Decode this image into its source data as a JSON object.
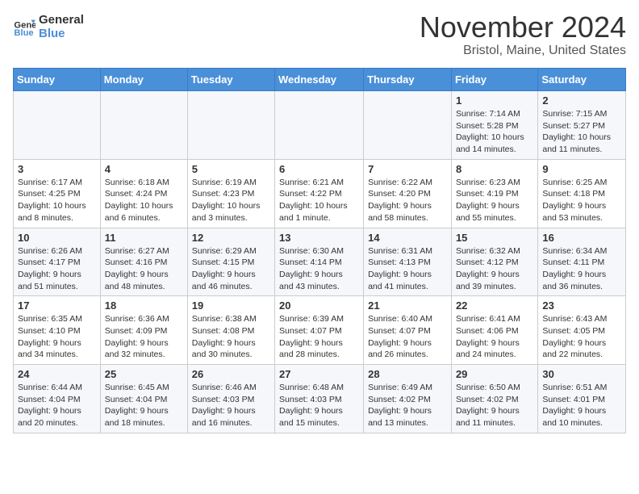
{
  "logo": {
    "text_general": "General",
    "text_blue": "Blue"
  },
  "header": {
    "month": "November 2024",
    "location": "Bristol, Maine, United States"
  },
  "weekdays": [
    "Sunday",
    "Monday",
    "Tuesday",
    "Wednesday",
    "Thursday",
    "Friday",
    "Saturday"
  ],
  "weeks": [
    [
      {
        "day": "",
        "info": ""
      },
      {
        "day": "",
        "info": ""
      },
      {
        "day": "",
        "info": ""
      },
      {
        "day": "",
        "info": ""
      },
      {
        "day": "",
        "info": ""
      },
      {
        "day": "1",
        "info": "Sunrise: 7:14 AM\nSunset: 5:28 PM\nDaylight: 10 hours and 14 minutes."
      },
      {
        "day": "2",
        "info": "Sunrise: 7:15 AM\nSunset: 5:27 PM\nDaylight: 10 hours and 11 minutes."
      }
    ],
    [
      {
        "day": "3",
        "info": "Sunrise: 6:17 AM\nSunset: 4:25 PM\nDaylight: 10 hours and 8 minutes."
      },
      {
        "day": "4",
        "info": "Sunrise: 6:18 AM\nSunset: 4:24 PM\nDaylight: 10 hours and 6 minutes."
      },
      {
        "day": "5",
        "info": "Sunrise: 6:19 AM\nSunset: 4:23 PM\nDaylight: 10 hours and 3 minutes."
      },
      {
        "day": "6",
        "info": "Sunrise: 6:21 AM\nSunset: 4:22 PM\nDaylight: 10 hours and 1 minute."
      },
      {
        "day": "7",
        "info": "Sunrise: 6:22 AM\nSunset: 4:20 PM\nDaylight: 9 hours and 58 minutes."
      },
      {
        "day": "8",
        "info": "Sunrise: 6:23 AM\nSunset: 4:19 PM\nDaylight: 9 hours and 55 minutes."
      },
      {
        "day": "9",
        "info": "Sunrise: 6:25 AM\nSunset: 4:18 PM\nDaylight: 9 hours and 53 minutes."
      }
    ],
    [
      {
        "day": "10",
        "info": "Sunrise: 6:26 AM\nSunset: 4:17 PM\nDaylight: 9 hours and 51 minutes."
      },
      {
        "day": "11",
        "info": "Sunrise: 6:27 AM\nSunset: 4:16 PM\nDaylight: 9 hours and 48 minutes."
      },
      {
        "day": "12",
        "info": "Sunrise: 6:29 AM\nSunset: 4:15 PM\nDaylight: 9 hours and 46 minutes."
      },
      {
        "day": "13",
        "info": "Sunrise: 6:30 AM\nSunset: 4:14 PM\nDaylight: 9 hours and 43 minutes."
      },
      {
        "day": "14",
        "info": "Sunrise: 6:31 AM\nSunset: 4:13 PM\nDaylight: 9 hours and 41 minutes."
      },
      {
        "day": "15",
        "info": "Sunrise: 6:32 AM\nSunset: 4:12 PM\nDaylight: 9 hours and 39 minutes."
      },
      {
        "day": "16",
        "info": "Sunrise: 6:34 AM\nSunset: 4:11 PM\nDaylight: 9 hours and 36 minutes."
      }
    ],
    [
      {
        "day": "17",
        "info": "Sunrise: 6:35 AM\nSunset: 4:10 PM\nDaylight: 9 hours and 34 minutes."
      },
      {
        "day": "18",
        "info": "Sunrise: 6:36 AM\nSunset: 4:09 PM\nDaylight: 9 hours and 32 minutes."
      },
      {
        "day": "19",
        "info": "Sunrise: 6:38 AM\nSunset: 4:08 PM\nDaylight: 9 hours and 30 minutes."
      },
      {
        "day": "20",
        "info": "Sunrise: 6:39 AM\nSunset: 4:07 PM\nDaylight: 9 hours and 28 minutes."
      },
      {
        "day": "21",
        "info": "Sunrise: 6:40 AM\nSunset: 4:07 PM\nDaylight: 9 hours and 26 minutes."
      },
      {
        "day": "22",
        "info": "Sunrise: 6:41 AM\nSunset: 4:06 PM\nDaylight: 9 hours and 24 minutes."
      },
      {
        "day": "23",
        "info": "Sunrise: 6:43 AM\nSunset: 4:05 PM\nDaylight: 9 hours and 22 minutes."
      }
    ],
    [
      {
        "day": "24",
        "info": "Sunrise: 6:44 AM\nSunset: 4:04 PM\nDaylight: 9 hours and 20 minutes."
      },
      {
        "day": "25",
        "info": "Sunrise: 6:45 AM\nSunset: 4:04 PM\nDaylight: 9 hours and 18 minutes."
      },
      {
        "day": "26",
        "info": "Sunrise: 6:46 AM\nSunset: 4:03 PM\nDaylight: 9 hours and 16 minutes."
      },
      {
        "day": "27",
        "info": "Sunrise: 6:48 AM\nSunset: 4:03 PM\nDaylight: 9 hours and 15 minutes."
      },
      {
        "day": "28",
        "info": "Sunrise: 6:49 AM\nSunset: 4:02 PM\nDaylight: 9 hours and 13 minutes."
      },
      {
        "day": "29",
        "info": "Sunrise: 6:50 AM\nSunset: 4:02 PM\nDaylight: 9 hours and 11 minutes."
      },
      {
        "day": "30",
        "info": "Sunrise: 6:51 AM\nSunset: 4:01 PM\nDaylight: 9 hours and 10 minutes."
      }
    ]
  ]
}
